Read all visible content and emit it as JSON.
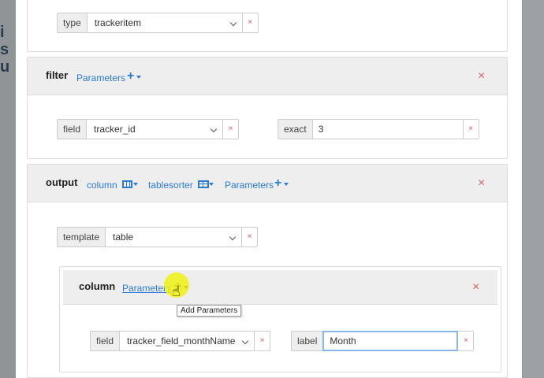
{
  "backdrop": {
    "text": "i\ns\nu"
  },
  "type_row": {
    "label": "type",
    "value": "trackeritem",
    "delete": "×"
  },
  "filter": {
    "title": "filter",
    "params_link": "Parameters",
    "field_row": {
      "label": "field",
      "value": "tracker_id",
      "delete": "×"
    },
    "exact_row": {
      "label": "exact",
      "value": "3",
      "delete": "×"
    },
    "close": "×"
  },
  "output": {
    "title": "output",
    "links": {
      "column": "column",
      "tablesorter": "tablesorter",
      "parameters": "Parameters"
    },
    "template_row": {
      "label": "template",
      "value": "table",
      "delete": "×"
    },
    "close": "×"
  },
  "column": {
    "title": "column",
    "params_link": "Parameters",
    "tooltip": "Add Parameters",
    "field_row": {
      "label": "field",
      "value": "tracker_field_monthName",
      "delete": "×"
    },
    "label_row": {
      "label": "label",
      "value": "Month",
      "delete": "×"
    },
    "close": "×"
  },
  "colors": {
    "link": "#2a7ad8",
    "close": "#e06060",
    "header_bg": "#eeeeee",
    "focus_border": "#8ab8ee",
    "cursor_highlight": "#f0f014"
  },
  "icons": [
    "plus-icon",
    "caret-down-icon",
    "columns-icon",
    "table-icon",
    "close-icon",
    "hand-cursor-icon",
    "chevron-down-icon"
  ]
}
